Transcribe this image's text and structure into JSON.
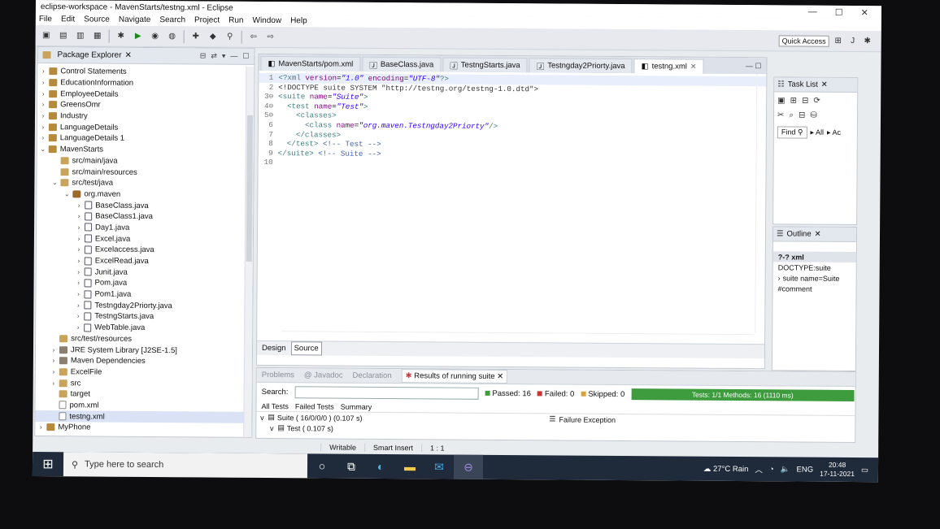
{
  "window": {
    "title": "eclipse-workspace - MavenStarts/testng.xml - Eclipse"
  },
  "menu": [
    "File",
    "Edit",
    "Source",
    "Navigate",
    "Search",
    "Project",
    "Run",
    "Window",
    "Help"
  ],
  "quick_access": "Quick Access",
  "package_explorer": {
    "title": "Package Explorer",
    "items": [
      {
        "label": "Control Statements",
        "lvl": 0,
        "arrow": ">",
        "icon": "proj"
      },
      {
        "label": "EducationInformation",
        "lvl": 0,
        "arrow": ">",
        "icon": "proj"
      },
      {
        "label": "EmployeeDetails",
        "lvl": 0,
        "arrow": ">",
        "icon": "proj"
      },
      {
        "label": "GreensOmr",
        "lvl": 0,
        "arrow": ">",
        "icon": "proj"
      },
      {
        "label": "Industry",
        "lvl": 0,
        "arrow": ">",
        "icon": "proj"
      },
      {
        "label": "LanguageDetails",
        "lvl": 0,
        "arrow": ">",
        "icon": "proj"
      },
      {
        "label": "LanguageDetails 1",
        "lvl": 0,
        "arrow": ">",
        "icon": "proj"
      },
      {
        "label": "MavenStarts",
        "lvl": 0,
        "arrow": "v",
        "icon": "proj"
      },
      {
        "label": "src/main/java",
        "lvl": 1,
        "arrow": "",
        "icon": "fold"
      },
      {
        "label": "src/main/resources",
        "lvl": 1,
        "arrow": "",
        "icon": "fold"
      },
      {
        "label": "src/test/java",
        "lvl": 1,
        "arrow": "v",
        "icon": "fold"
      },
      {
        "label": "org.maven",
        "lvl": 2,
        "arrow": "v",
        "icon": "pkg"
      },
      {
        "label": "BaseClass.java",
        "lvl": 3,
        "arrow": ">",
        "icon": "java"
      },
      {
        "label": "BaseClass1.java",
        "lvl": 3,
        "arrow": ">",
        "icon": "java"
      },
      {
        "label": "Day1.java",
        "lvl": 3,
        "arrow": ">",
        "icon": "java"
      },
      {
        "label": "Excel.java",
        "lvl": 3,
        "arrow": ">",
        "icon": "java"
      },
      {
        "label": "Excelaccess.java",
        "lvl": 3,
        "arrow": ">",
        "icon": "java"
      },
      {
        "label": "ExcelRead.java",
        "lvl": 3,
        "arrow": ">",
        "icon": "java"
      },
      {
        "label": "Junit.java",
        "lvl": 3,
        "arrow": ">",
        "icon": "java"
      },
      {
        "label": "Pom.java",
        "lvl": 3,
        "arrow": ">",
        "icon": "java"
      },
      {
        "label": "Pom1.java",
        "lvl": 3,
        "arrow": ">",
        "icon": "java"
      },
      {
        "label": "Testngday2Priorty.java",
        "lvl": 3,
        "arrow": ">",
        "icon": "java"
      },
      {
        "label": "TestngStarts.java",
        "lvl": 3,
        "arrow": ">",
        "icon": "java"
      },
      {
        "label": "WebTable.java",
        "lvl": 3,
        "arrow": ">",
        "icon": "java"
      },
      {
        "label": "src/test/resources",
        "lvl": 1,
        "arrow": "",
        "icon": "fold"
      },
      {
        "label": "JRE System Library [J2SE-1.5]",
        "lvl": 1,
        "arrow": ">",
        "icon": "lib"
      },
      {
        "label": "Maven Dependencies",
        "lvl": 1,
        "arrow": ">",
        "icon": "lib"
      },
      {
        "label": "ExcelFile",
        "lvl": 1,
        "arrow": ">",
        "icon": "fold"
      },
      {
        "label": "src",
        "lvl": 1,
        "arrow": ">",
        "icon": "fold"
      },
      {
        "label": "target",
        "lvl": 1,
        "arrow": "",
        "icon": "fold"
      },
      {
        "label": "pom.xml",
        "lvl": 1,
        "arrow": "",
        "icon": "xml"
      },
      {
        "label": "testng.xml",
        "lvl": 1,
        "arrow": "",
        "icon": "xml"
      },
      {
        "label": "MyPhone",
        "lvl": 0,
        "arrow": ">",
        "icon": "proj"
      }
    ]
  },
  "editor": {
    "tabs": [
      "MavenStarts/pom.xml",
      "BaseClass.java",
      "TestngStarts.java",
      "Testngday2Priorty.java",
      "testng.xml"
    ],
    "active_tab": "testng.xml",
    "lines": [
      {
        "n": "1",
        "html": "<span class='tg'>&lt;?xml</span> <span class='at'>version</span>=<span class='vs'>\"1.0\"</span> <span class='at'>encoding</span>=<span class='vs'>\"UTF-8\"</span><span class='tg'>?&gt;</span>"
      },
      {
        "n": "2",
        "html": "<span class='dt'>&lt;!DOCTYPE suite SYSTEM \"http://testng.org/testng-1.0.dtd\"&gt;</span>"
      },
      {
        "n": "3⊖",
        "html": "<span class='tg'>&lt;suite</span> <span class='at'>name</span>=<span class='vs'>\"Suite\"</span><span class='tg'>&gt;</span>"
      },
      {
        "n": "4⊖",
        "html": "  <span class='tg'>&lt;test</span> <span class='at'>name</span>=<span class='vs'>\"Test\"</span><span class='tg'>&gt;</span>"
      },
      {
        "n": "5⊖",
        "html": "    <span class='tg'>&lt;classes&gt;</span>"
      },
      {
        "n": "6",
        "html": "      <span class='tg'>&lt;class</span> <span class='at'>name</span>=<span class='vs'>\"org.maven.Testngday2Priorty\"</span><span class='tg'>/&gt;</span>"
      },
      {
        "n": "7",
        "html": "    <span class='tg'>&lt;/classes&gt;</span>"
      },
      {
        "n": "8",
        "html": "  <span class='tg'>&lt;/test&gt;</span> <span class='cm'>&lt;!-- Test --&gt;</span>"
      },
      {
        "n": "9",
        "html": "<span class='tg'>&lt;/suite&gt;</span> <span class='cm'>&lt;!-- Suite --&gt;</span>"
      },
      {
        "n": "10",
        "html": ""
      }
    ],
    "mode_tabs": [
      "Design",
      "Source"
    ]
  },
  "task_list": {
    "title": "Task List",
    "find": "Find",
    "all": "All",
    "ac": "Ac"
  },
  "outline": {
    "title": "Outline",
    "items": [
      "?-? xml",
      "DOCTYPE:suite",
      "suite name=Suite",
      "#comment"
    ]
  },
  "bottom": {
    "tabs": [
      "Problems",
      "@ Javadoc",
      "Declaration",
      "Results of running suite"
    ],
    "search_label": "Search:",
    "passed": "Passed: 16",
    "failed": "Failed: 0",
    "skipped": "Skipped: 0",
    "progress_text": "Tests: 1/1  Methods: 16 (1110 ms)",
    "progress": 1.0,
    "result_tabs": [
      "All Tests",
      "Failed Tests",
      "Summary"
    ],
    "tree": [
      "Suite ( 16/0/0/0 ) (0.107 s)",
      "Test ( 0.107 s)"
    ],
    "failure": "Failure Exception"
  },
  "status": {
    "writable": "Writable",
    "insert": "Smart Insert",
    "pos": "1 : 1"
  },
  "taskbar": {
    "search": "Type here to search",
    "weather": "27°C  Rain",
    "lang": "ENG",
    "time": "20:48",
    "date": "17-11-2021"
  },
  "colors": {
    "progress": "#3e9b3e",
    "taskbar": "#1f2a3a"
  }
}
